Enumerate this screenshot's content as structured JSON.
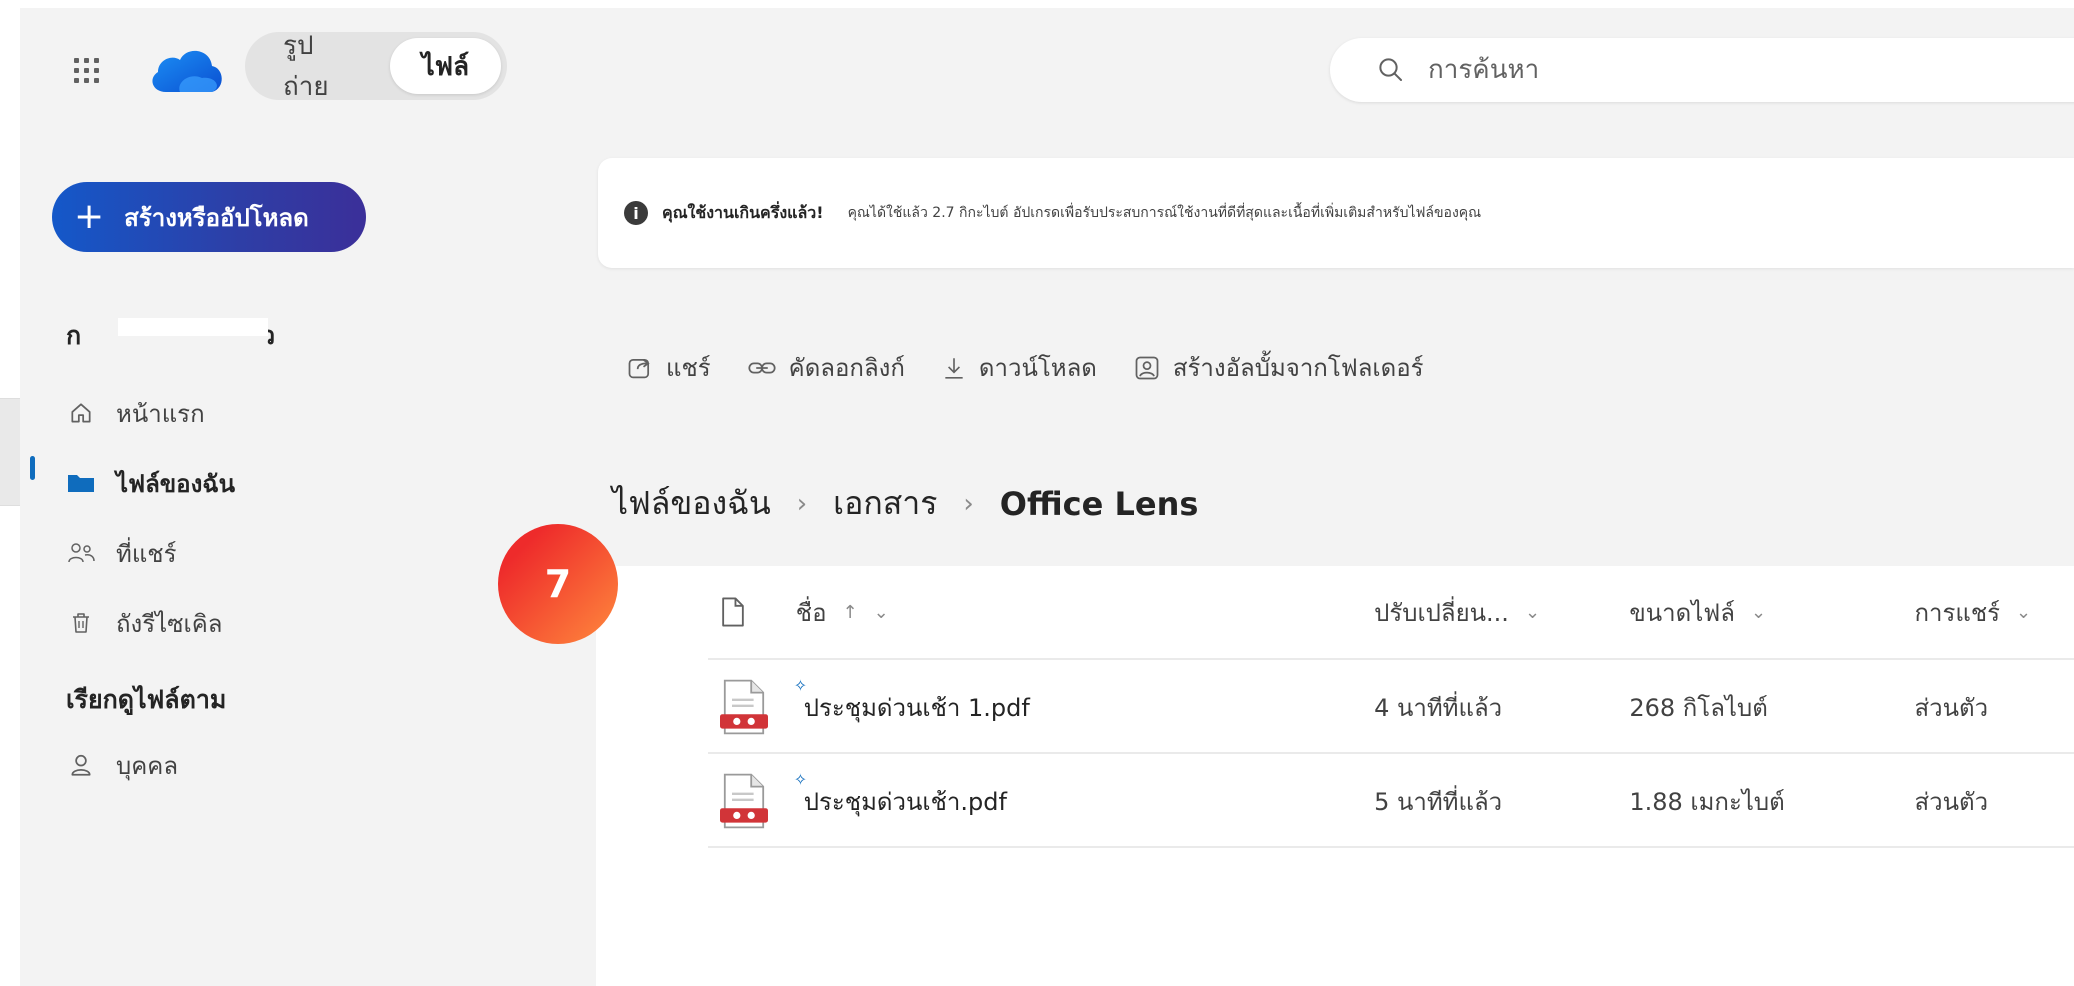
{
  "header": {
    "pivot": [
      {
        "label": "รูปถ่าย",
        "active": false
      },
      {
        "label": "ไฟล์",
        "active": true
      }
    ],
    "search_placeholder": "การค้นหา"
  },
  "sidebar": {
    "create_label": "สร้างหรืออัปโหลด",
    "user_name_start": "ก",
    "user_name_end": "ว",
    "nav": [
      {
        "label": "หน้าแรก",
        "icon": "home-icon"
      },
      {
        "label": "ไฟล์ของฉัน",
        "icon": "folder-icon",
        "active": true
      },
      {
        "label": "ที่แชร์",
        "icon": "people-icon"
      },
      {
        "label": "ถังรีไซเคิล",
        "icon": "trash-icon"
      }
    ],
    "browse_by_title": "เรียกดูไฟล์ตาม",
    "people_label": "บุคคล"
  },
  "banner": {
    "title": "คุณใช้งานเกินครึ่งแล้ว!",
    "text": "คุณได้ใช้แล้ว 2.7 กิกะไบต์ อัปเกรดเพื่อรับประสบการณ์ใช้งานที่ดีที่สุดและเนื้อที่เพิ่มเติมสำหรับไฟล์ของคุณ"
  },
  "toolbar": {
    "share": "แชร์",
    "copy_link": "คัดลอกลิงก์",
    "download": "ดาวน์โหลด",
    "create_album": "สร้างอัลบั้มจากโฟลเดอร์"
  },
  "breadcrumb": [
    "ไฟล์ของฉัน",
    "เอกสาร",
    "Office Lens"
  ],
  "step_badge": "7",
  "list": {
    "columns": {
      "name": "ชื่อ",
      "modified": "ปรับเปลี่ยน...",
      "size": "ขนาดไฟล์",
      "sharing": "การแชร์"
    },
    "rows": [
      {
        "name": "ประชุมด่วนเช้า 1.pdf",
        "modified": "4 นาทีที่แล้ว",
        "size": "268 กิโลไบต์",
        "sharing": "ส่วนตัว"
      },
      {
        "name": "ประชุมด่วนเช้า.pdf",
        "modified": "5 นาทีที่แล้ว",
        "size": "1.88 เมกะไบต์",
        "sharing": "ส่วนตัว"
      }
    ]
  },
  "colors": {
    "accent": "#0f6cbd",
    "badge_start": "#ee2b2b",
    "badge_end": "#ff8a3d",
    "pdf_red": "#d13438"
  }
}
